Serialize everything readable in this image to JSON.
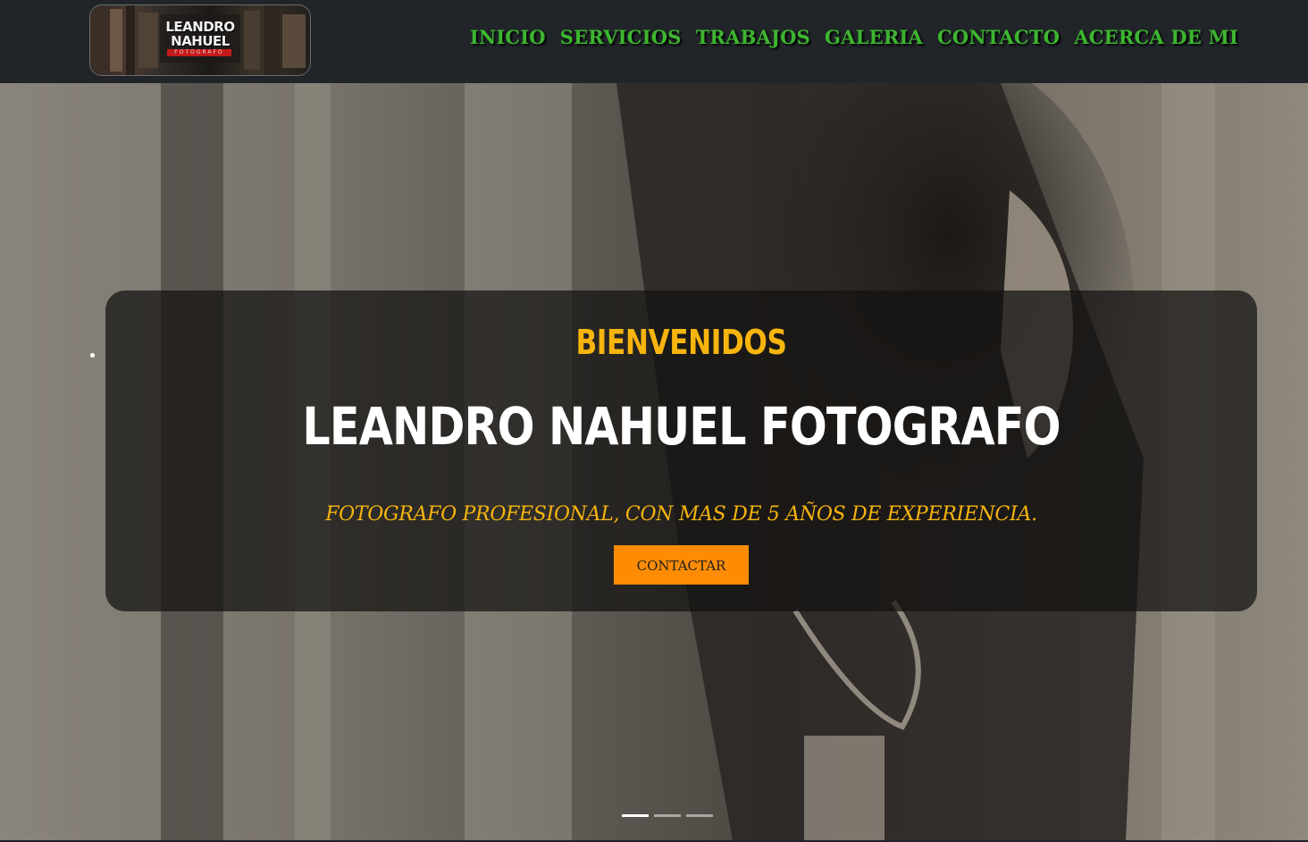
{
  "header": {
    "logo": {
      "line1": "LEANDRO",
      "line2": "NAHUEL",
      "ribbon": "FOTOGRAFO"
    },
    "nav": [
      {
        "label": "INICIO"
      },
      {
        "label": "SERVICIOS"
      },
      {
        "label": "TRABAJOS"
      },
      {
        "label": "GALERIA"
      },
      {
        "label": "CONTACTO"
      },
      {
        "label": "ACERCA DE MI"
      }
    ]
  },
  "hero": {
    "welcome": "BIENVENIDOS",
    "title": "LEANDRO NAHUEL FOTOGRAFO",
    "subtitle": "FOTOGRAFO PROFESIONAL, CON MAS DE 5 AÑOS DE EXPERIENCIA.",
    "cta_label": "CONTACTAR",
    "slides_total": 3,
    "active_slide": 1
  },
  "colors": {
    "navbar_bg": "#212529",
    "nav_text": "#3cb62f",
    "accent_yellow": "#f6b40d",
    "cta_orange": "#fd8c04"
  }
}
